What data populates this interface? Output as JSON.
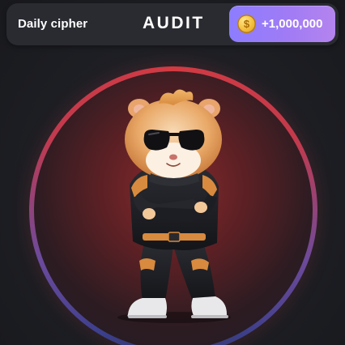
{
  "header": {
    "daily_label": "Daily cipher",
    "cipher_word": "AUDIT",
    "reward_amount": "+1,000,000",
    "coin_symbol": "$"
  },
  "mascot": {
    "icon": "hamster-mascot-icon"
  },
  "colors": {
    "background": "#1b1c21",
    "topbar": "#2a2b31",
    "reward_gradient_start": "#8c7dff",
    "reward_gradient_end": "#b484ee",
    "coin": "#f6c445",
    "ring_top": "#d23a42",
    "ring_bottom": "#3b3f8c"
  }
}
